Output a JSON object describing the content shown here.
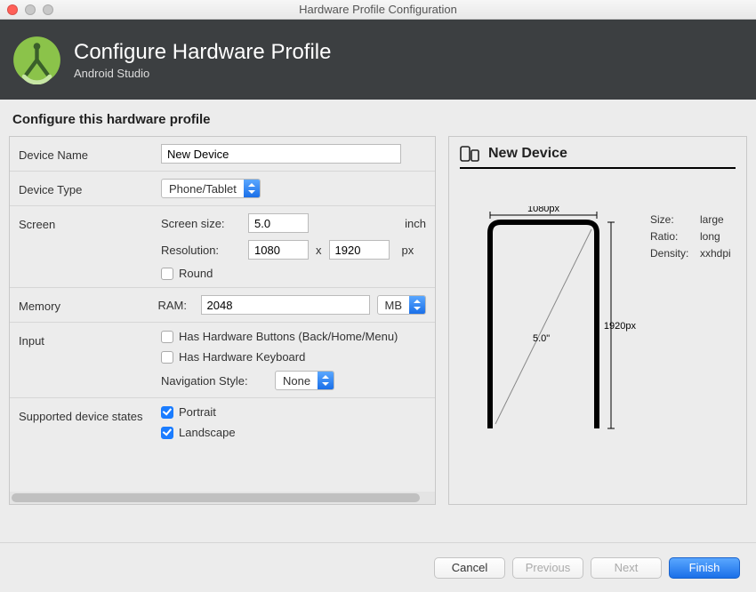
{
  "window": {
    "title": "Hardware Profile Configuration"
  },
  "banner": {
    "heading": "Configure Hardware Profile",
    "subtitle": "Android Studio"
  },
  "section_title": "Configure this hardware profile",
  "labels": {
    "device_name": "Device Name",
    "device_type": "Device Type",
    "screen": "Screen",
    "screen_size": "Screen size:",
    "resolution": "Resolution:",
    "round": "Round",
    "memory": "Memory",
    "ram": "RAM:",
    "input": "Input",
    "hw_buttons": "Has Hardware Buttons (Back/Home/Menu)",
    "hw_keyboard": "Has Hardware Keyboard",
    "nav_style": "Navigation Style:",
    "supported_states": "Supported device states",
    "portrait": "Portrait",
    "landscape": "Landscape",
    "inch": "inch",
    "px": "px",
    "x": "x",
    "mb": "MB"
  },
  "values": {
    "device_name": "New Device",
    "device_type": "Phone/Tablet",
    "screen_size": "5.0",
    "res_w": "1080",
    "res_h": "1920",
    "round_checked": false,
    "ram": "2048",
    "ram_unit": "MB",
    "hw_buttons_checked": false,
    "hw_keyboard_checked": false,
    "nav_style": "None",
    "portrait_checked": true,
    "landscape_checked": true
  },
  "preview": {
    "title": "New Device",
    "width_label": "1080px",
    "height_label": "1920px",
    "diag_label": "5.0\"",
    "size_k": "Size:",
    "size_v": "large",
    "ratio_k": "Ratio:",
    "ratio_v": "long",
    "density_k": "Density:",
    "density_v": "xxhdpi"
  },
  "buttons": {
    "cancel": "Cancel",
    "previous": "Previous",
    "next": "Next",
    "finish": "Finish"
  }
}
